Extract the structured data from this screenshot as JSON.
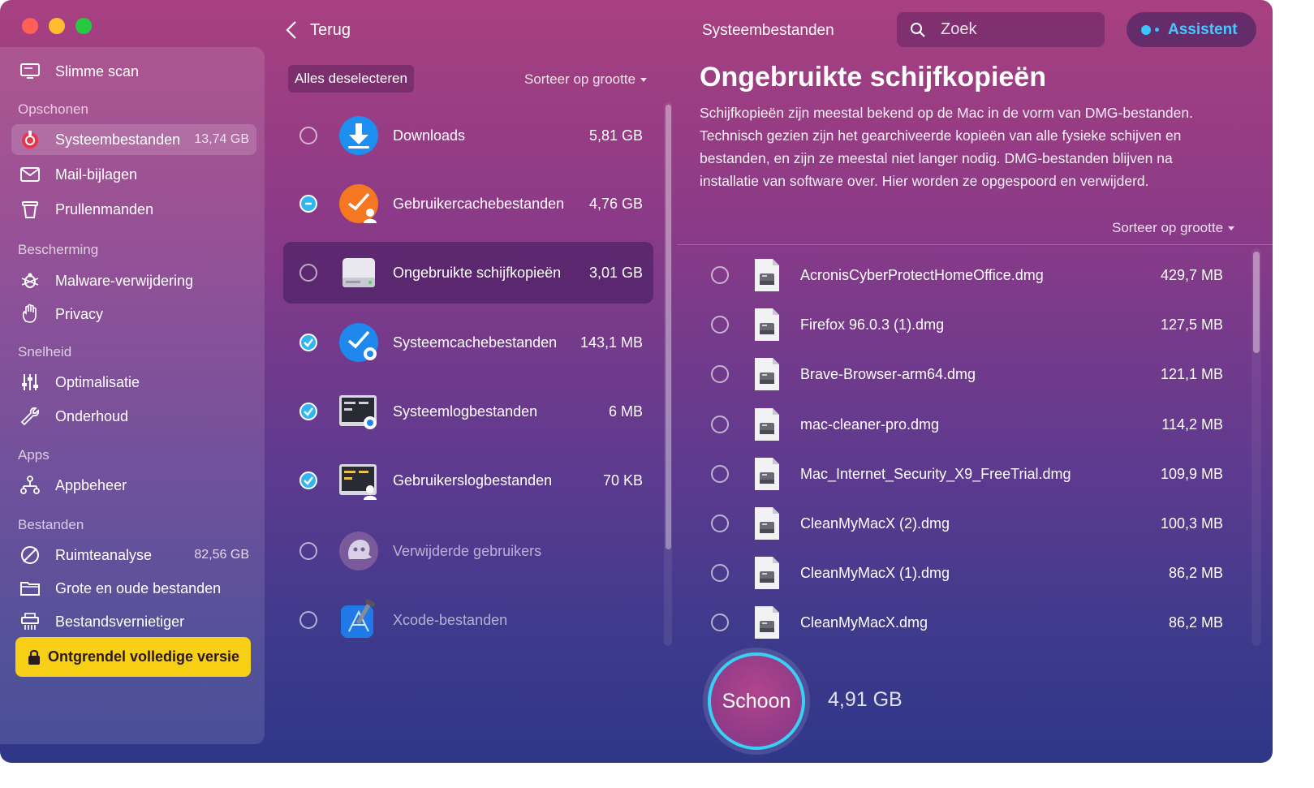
{
  "window": {
    "back_label": "Terug",
    "title": "Systeembestanden",
    "search_placeholder": "Zoek",
    "assistant_label": "Assistent"
  },
  "sidebar": {
    "smart_scan": "Slimme scan",
    "sections": {
      "cleanup": "Opschonen",
      "protection": "Bescherming",
      "speed": "Snelheid",
      "apps": "Apps",
      "files": "Bestanden"
    },
    "items": {
      "system_junk": {
        "label": "Systeembestanden",
        "value": "13,74 GB"
      },
      "mail_attachments": {
        "label": "Mail-bijlagen"
      },
      "trash": {
        "label": "Prullenmanden"
      },
      "malware": {
        "label": "Malware-verwijdering"
      },
      "privacy": {
        "label": "Privacy"
      },
      "optimization": {
        "label": "Optimalisatie"
      },
      "maintenance": {
        "label": "Onderhoud"
      },
      "uninstaller": {
        "label": "Appbeheer"
      },
      "space_lens": {
        "label": "Ruimteanalyse",
        "value": "82,56 GB"
      },
      "large_old": {
        "label": "Grote en oude bestanden"
      },
      "shredder": {
        "label": "Bestandsvernietiger"
      }
    },
    "unlock_label": "Ontgrendel volledige versie"
  },
  "categories": {
    "deselect_label": "Alles deselecteren",
    "sort_label": "Sorteer op grootte",
    "items": [
      {
        "label": "Downloads",
        "size": "5,81 GB",
        "state": "off",
        "icon": "download-icon"
      },
      {
        "label": "Gebruikercachebestanden",
        "size": "4,76 GB",
        "state": "partial",
        "icon": "user-cache-icon"
      },
      {
        "label": "Ongebruikte schijfkopieën",
        "size": "3,01 GB",
        "state": "off",
        "icon": "disk-image-icon",
        "selected": true
      },
      {
        "label": "Systeemcachebestanden",
        "size": "143,1 MB",
        "state": "on",
        "icon": "system-cache-icon"
      },
      {
        "label": "Systeemlogbestanden",
        "size": "6 MB",
        "state": "on",
        "icon": "system-log-icon"
      },
      {
        "label": "Gebruikerslogbestanden",
        "size": "70 KB",
        "state": "on",
        "icon": "user-log-icon"
      },
      {
        "label": "Verwijderde gebruikers",
        "size": "",
        "state": "off",
        "icon": "deleted-users-icon",
        "dim": true
      },
      {
        "label": "Xcode-bestanden",
        "size": "",
        "state": "off",
        "icon": "xcode-icon",
        "dim": true
      }
    ]
  },
  "detail": {
    "title": "Ongebruikte schijfkopieën",
    "description": "Schijfkopieën zijn meestal bekend op de Mac in de vorm van DMG-bestanden. Technisch gezien zijn het gearchiveerde kopieën van alle fysieke schijven en bestanden, en zijn ze meestal niet langer nodig. DMG-bestanden blijven na installatie van software over. Hier worden ze opgespoord en verwijderd.",
    "sort_label": "Sorteer op grootte",
    "files": [
      {
        "name": "AcronisCyberProtectHomeOffice.dmg",
        "size": "429,7 MB"
      },
      {
        "name": "Firefox 96.0.3 (1).dmg",
        "size": "127,5 MB"
      },
      {
        "name": "Brave-Browser-arm64.dmg",
        "size": "121,1 MB"
      },
      {
        "name": "mac-cleaner-pro.dmg",
        "size": "114,2 MB"
      },
      {
        "name": "Mac_Internet_Security_X9_FreeTrial.dmg",
        "size": "109,9 MB"
      },
      {
        "name": "CleanMyMacX (2).dmg",
        "size": "100,3 MB"
      },
      {
        "name": "CleanMyMacX (1).dmg",
        "size": "86,2 MB"
      },
      {
        "name": "CleanMyMacX.dmg",
        "size": "86,2 MB"
      }
    ]
  },
  "footer": {
    "clean_label": "Schoon",
    "total_size": "4,91 GB"
  },
  "colors": {
    "accent_blue": "#31b6f2",
    "unlock_yellow": "#f7cf15",
    "ring_cyan": "#3ad0f5"
  }
}
